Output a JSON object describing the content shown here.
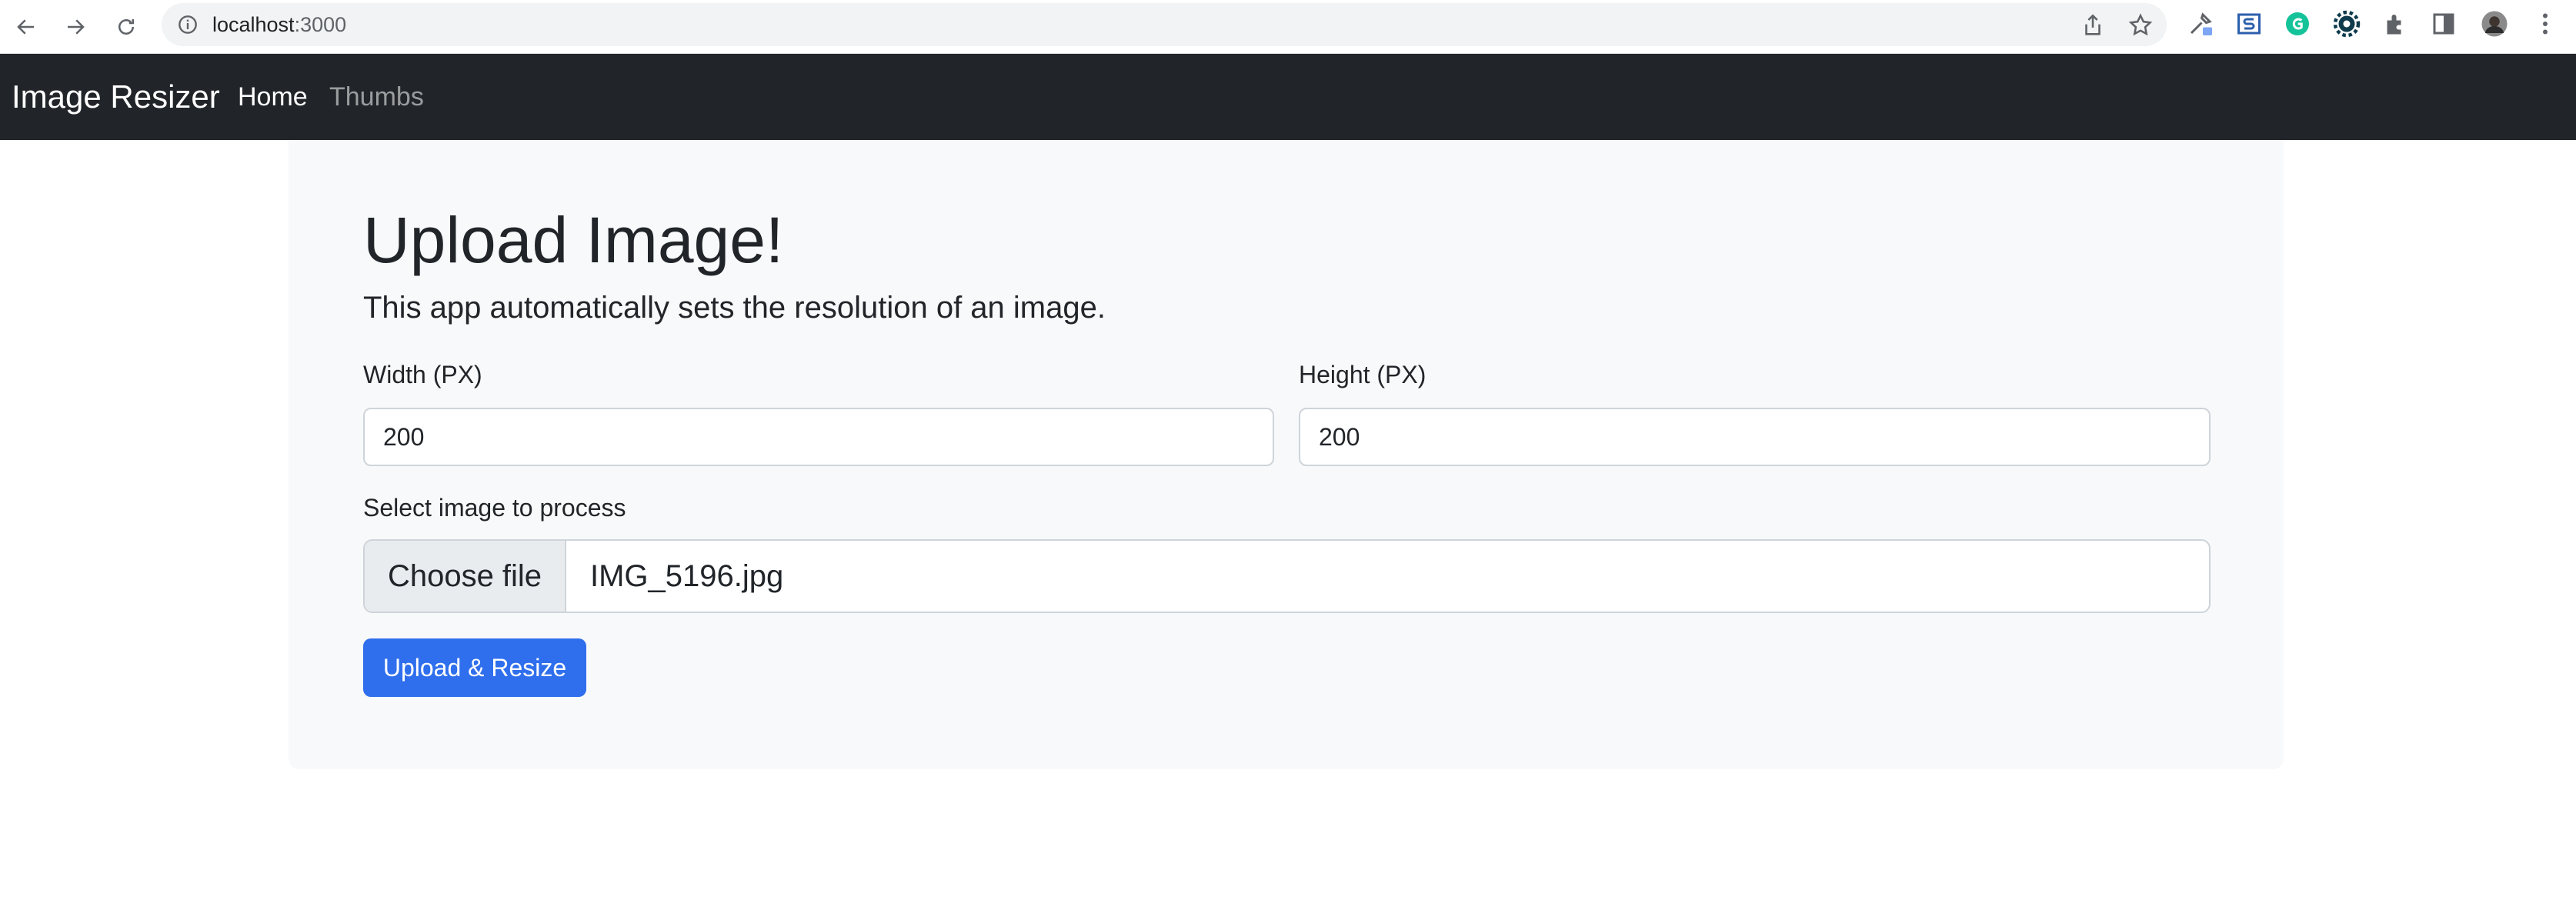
{
  "browser": {
    "url_host": "localhost",
    "url_port": ":3000",
    "icons": [
      "back-arrow-icon",
      "forward-arrow-icon",
      "reload-icon",
      "info-icon",
      "share-icon",
      "bookmark-star-icon",
      "eyedropper-extension-icon",
      "s-extension-icon",
      "grammarly-extension-icon",
      "gear-extension-icon",
      "puzzle-extensions-icon",
      "side-panel-icon",
      "profile-avatar",
      "more-menu-icon"
    ]
  },
  "navbar": {
    "brand": "Image Resizer",
    "links": [
      {
        "label": "Home",
        "active": true
      },
      {
        "label": "Thumbs",
        "active": false
      }
    ]
  },
  "main": {
    "title": "Upload Image!",
    "lead": "This app automatically sets the resolution of an image.",
    "width": {
      "label": "Width (PX)",
      "value": "200"
    },
    "height": {
      "label": "Height (PX)",
      "value": "200"
    },
    "file": {
      "label": "Select image to process",
      "button": "Choose file",
      "filename": "IMG_5196.jpg"
    },
    "submit": "Upload & Resize"
  },
  "colors": {
    "navbar": "#212529",
    "card": "#f8f9fa",
    "primary": "#2f6fed"
  }
}
